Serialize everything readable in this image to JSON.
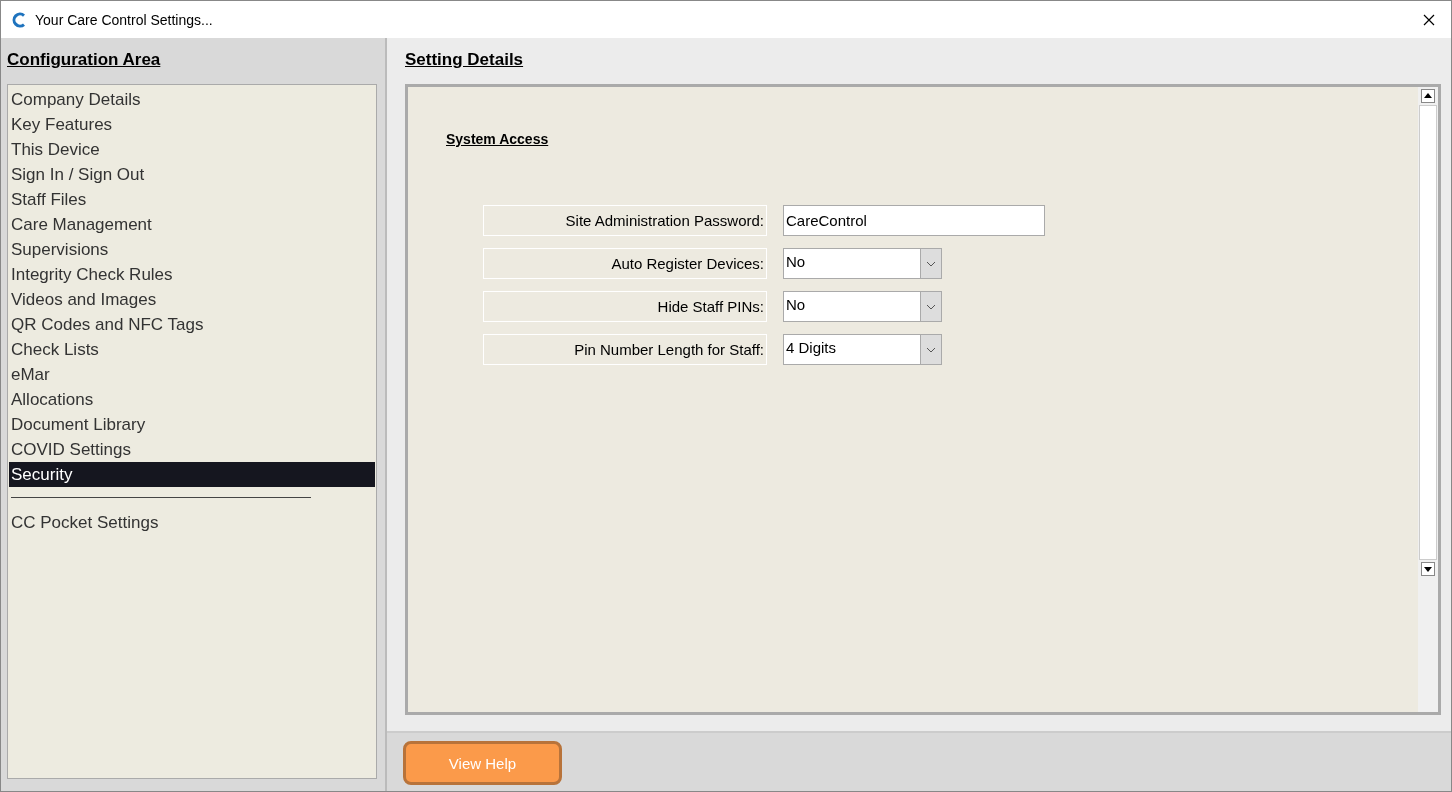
{
  "window": {
    "title": "Your Care Control Settings..."
  },
  "sidebar": {
    "heading": "Configuration Area",
    "items": [
      {
        "label": "Company Details",
        "selected": false
      },
      {
        "label": "Key Features",
        "selected": false
      },
      {
        "label": "This Device",
        "selected": false
      },
      {
        "label": "Sign In / Sign Out",
        "selected": false
      },
      {
        "label": "Staff Files",
        "selected": false
      },
      {
        "label": "Care Management",
        "selected": false
      },
      {
        "label": "Supervisions",
        "selected": false
      },
      {
        "label": "Integrity Check Rules",
        "selected": false
      },
      {
        "label": "Videos and Images",
        "selected": false
      },
      {
        "label": "QR Codes and NFC Tags",
        "selected": false
      },
      {
        "label": "Check Lists",
        "selected": false
      },
      {
        "label": "eMar",
        "selected": false
      },
      {
        "label": "Allocations",
        "selected": false
      },
      {
        "label": "Document Library",
        "selected": false
      },
      {
        "label": "COVID Settings",
        "selected": false
      },
      {
        "label": "Security",
        "selected": true
      }
    ],
    "extra_items": [
      {
        "label": "CC Pocket Settings",
        "selected": false
      }
    ]
  },
  "details": {
    "heading": "Setting Details",
    "section": "System Access",
    "fields": [
      {
        "kind": "text",
        "label": "Site Administration Password:",
        "value": "CareControl"
      },
      {
        "kind": "select",
        "label": "Auto Register Devices:",
        "value": "No"
      },
      {
        "kind": "select",
        "label": "Hide Staff PINs:",
        "value": "No"
      },
      {
        "kind": "select",
        "label": "Pin Number Length for Staff:",
        "value": "4 Digits"
      }
    ]
  },
  "footer": {
    "button": "View Help"
  }
}
